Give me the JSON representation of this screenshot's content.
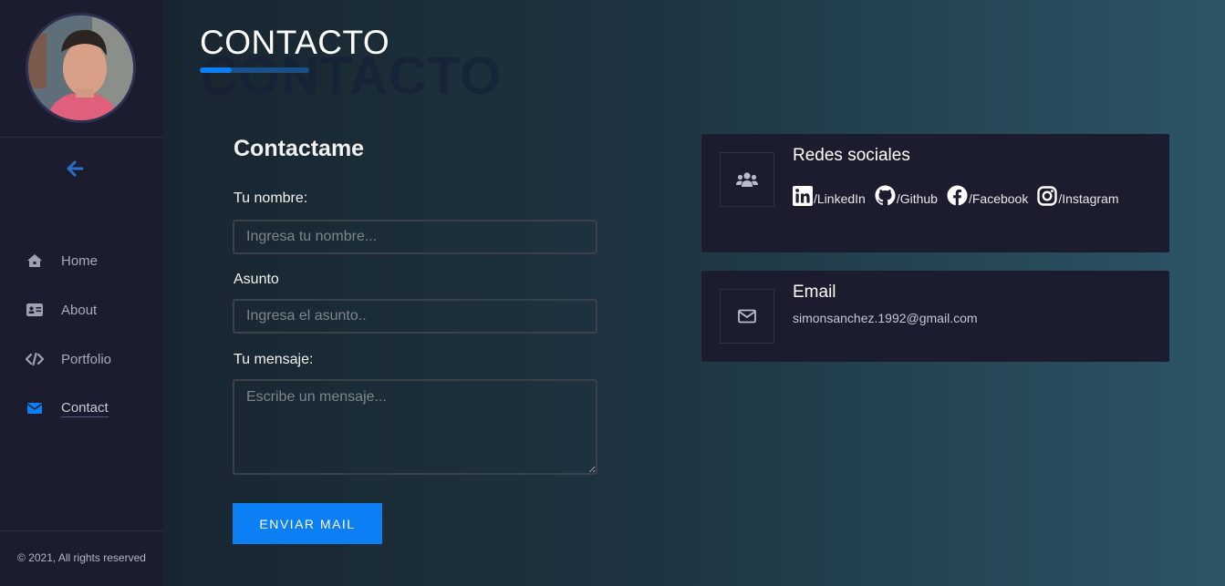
{
  "sidebar": {
    "nav": [
      {
        "label": "Home",
        "icon": "home-icon"
      },
      {
        "label": "About",
        "icon": "id-card-icon"
      },
      {
        "label": "Portfolio",
        "icon": "code-icon"
      },
      {
        "label": "Contact",
        "icon": "envelope-icon",
        "active": true
      }
    ],
    "copyright": "© 2021, All rights reserved"
  },
  "header": {
    "title": "CONTACTO",
    "title_shadow": "CONTACTO"
  },
  "form": {
    "title": "Contactame",
    "name_label": "Tu nombre:",
    "name_placeholder": "Ingresa tu nombre...",
    "subject_label": "Asunto",
    "subject_placeholder": "Ingresa el asunto..",
    "message_label": "Tu mensaje:",
    "message_placeholder": "Escribe un mensaje...",
    "submit_label": "ENVIAR MAIL"
  },
  "social_card": {
    "title": "Redes sociales",
    "icon": "users-icon",
    "links": [
      {
        "label": "/LinkedIn",
        "icon": "linkedin-icon"
      },
      {
        "label": "/Github",
        "icon": "github-icon"
      },
      {
        "label": "/Facebook",
        "icon": "facebook-icon"
      },
      {
        "label": "/Instagram",
        "icon": "instagram-icon"
      }
    ]
  },
  "email_card": {
    "title": "Email",
    "icon": "envelope-outline-icon",
    "value": "simonsanchez.1992@gmail.com"
  },
  "colors": {
    "accent": "#0d7ff5",
    "sidebar_bg": "#1b1d2e",
    "card_bg": "#1b1c2d"
  }
}
